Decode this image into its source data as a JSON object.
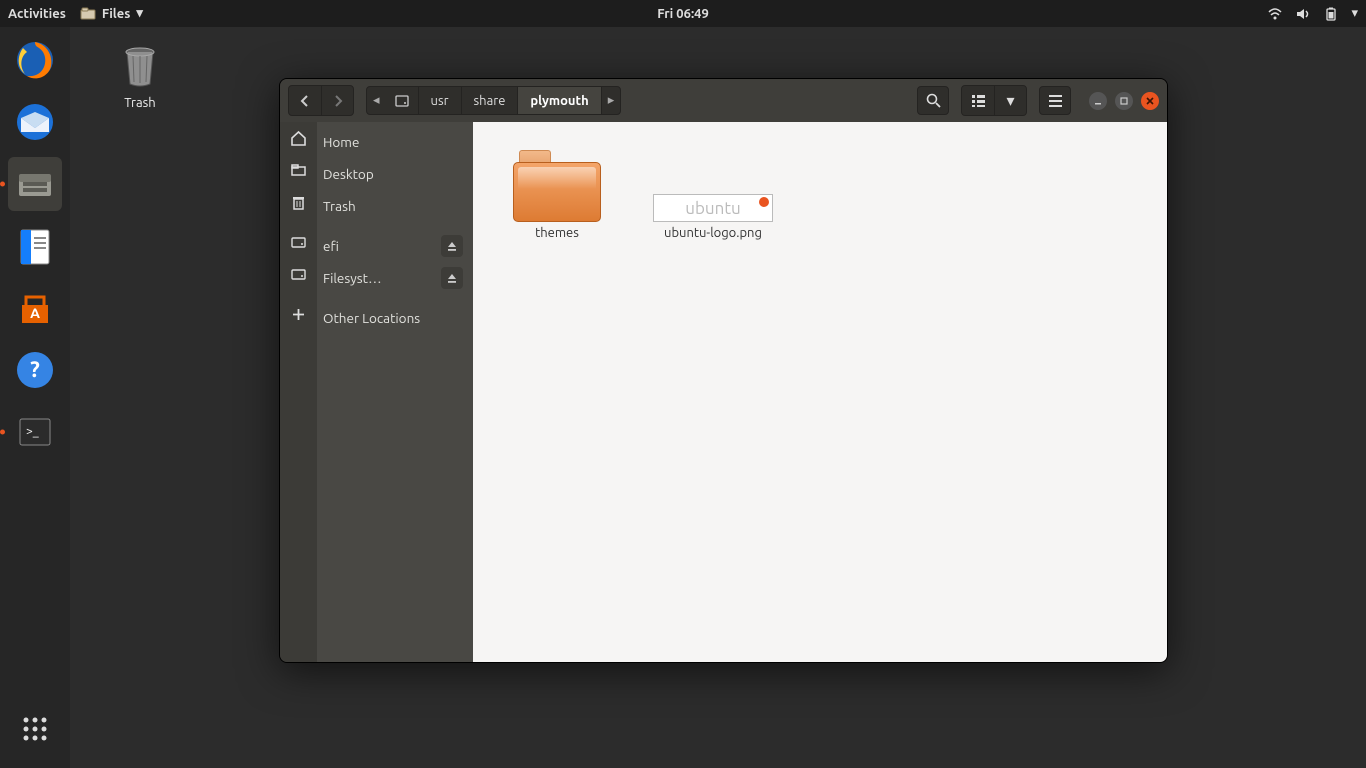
{
  "topbar": {
    "activities": "Activities",
    "app_menu": "Files",
    "clock": "Fri 06:49"
  },
  "desktop": {
    "trash_label": "Trash"
  },
  "dock": {
    "items": [
      "firefox",
      "thunderbird",
      "files",
      "writer",
      "software",
      "help",
      "terminal"
    ]
  },
  "window": {
    "path": {
      "root_icon": "disk",
      "segments": [
        "usr",
        "share",
        "plymouth"
      ],
      "current_index": 2
    },
    "sidebar": {
      "items": [
        {
          "icon": "home",
          "label": "Home"
        },
        {
          "icon": "desktop",
          "label": "Desktop"
        },
        {
          "icon": "trash",
          "label": "Trash"
        },
        {
          "icon": "disk",
          "label": "efi",
          "ejectable": true
        },
        {
          "icon": "disk",
          "label": "Filesyst…",
          "ejectable": true
        },
        {
          "icon": "plus",
          "label": "Other Locations"
        }
      ]
    },
    "content": {
      "items": [
        {
          "type": "folder",
          "label": "themes"
        },
        {
          "type": "image",
          "label": "ubuntu-logo.png",
          "thumb_text": "ubuntu"
        }
      ]
    }
  }
}
